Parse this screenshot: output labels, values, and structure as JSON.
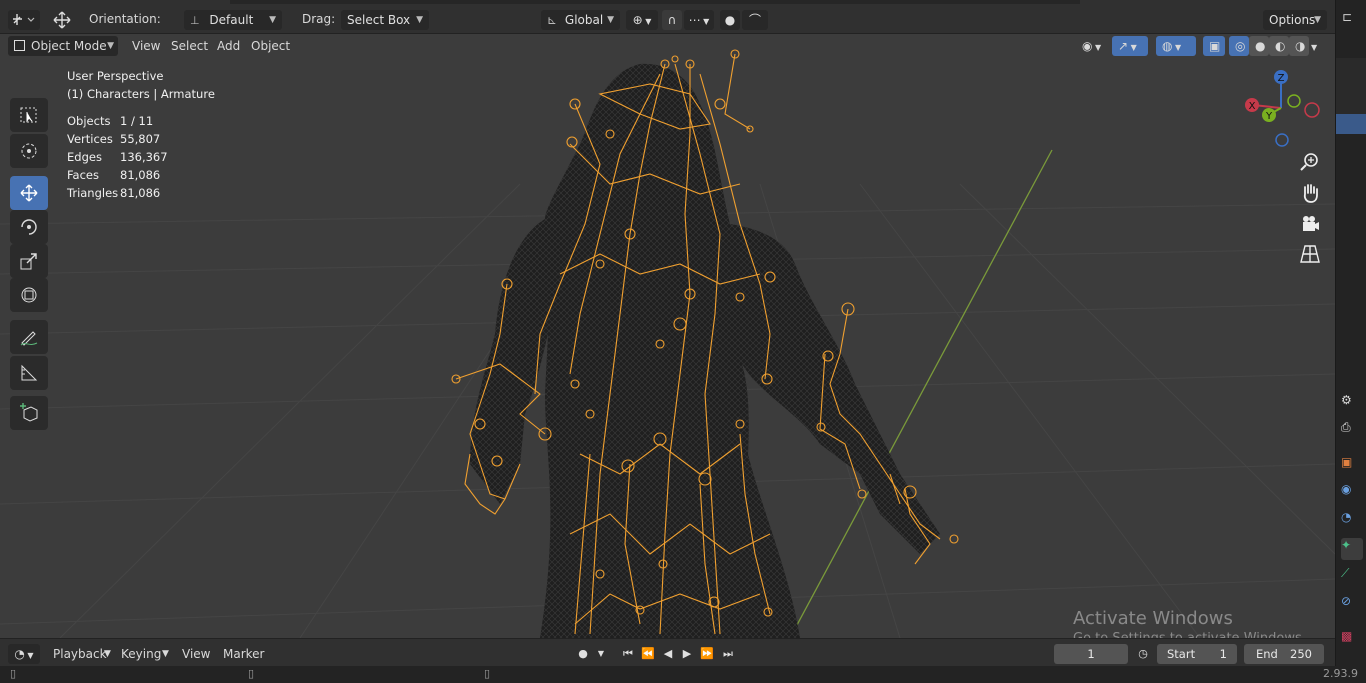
{
  "header": {
    "orientation_label": "Orientation:",
    "orientation_value": "Default",
    "drag_label": "Drag:",
    "drag_value": "Select Box",
    "transform_orientation": "Global",
    "options_label": "Options"
  },
  "menu": {
    "mode": "Object Mode",
    "items": [
      "View",
      "Select",
      "Add",
      "Object"
    ]
  },
  "viewport": {
    "perspective": "User Perspective",
    "context": "(1) Characters | Armature",
    "stats": [
      {
        "label": "Objects",
        "value": "1 / 11"
      },
      {
        "label": "Vertices",
        "value": "55,807"
      },
      {
        "label": "Edges",
        "value": "136,367"
      },
      {
        "label": "Faces",
        "value": "81,086"
      },
      {
        "label": "Triangles",
        "value": "81,086"
      }
    ],
    "gizmo": {
      "x": "X",
      "y": "Y",
      "z": "Z"
    }
  },
  "tools": [
    "select-box",
    "cursor",
    "move",
    "rotate",
    "scale",
    "transform",
    "annotate",
    "measure",
    "add-cube"
  ],
  "timeline": {
    "items": [
      "Playback",
      "Keying",
      "View",
      "Marker"
    ],
    "current_frame": "1",
    "start_label": "Start",
    "start_value": "1",
    "end_label": "End",
    "end_value": "250"
  },
  "status": {
    "version": "2.93.9"
  },
  "watermark": {
    "line1": "Activate Windows",
    "line2": "Go to Settings to activate Windows."
  },
  "colors": {
    "accent": "#4772b3",
    "bone": "#f0a030",
    "mesh": "#1a1a1a",
    "axis_y": "#7a9a3a"
  }
}
